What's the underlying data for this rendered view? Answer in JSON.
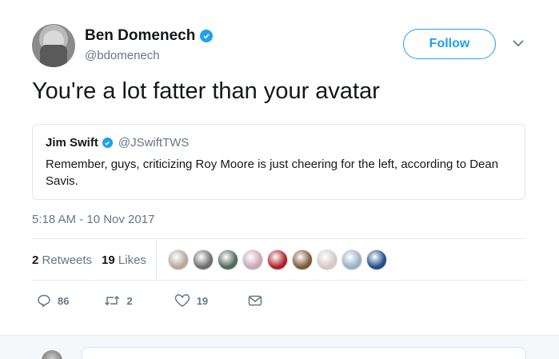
{
  "author": {
    "name": "Ben Domenech",
    "handle": "@bdomenech",
    "avatar_icon": "avatar-photo",
    "verified_icon": "verified-badge-icon"
  },
  "header": {
    "follow_label": "Follow",
    "menu_icon": "chevron-down-icon"
  },
  "tweet": {
    "text": "You're a lot fatter than your avatar",
    "timestamp": "5:18 AM - 10 Nov 2017"
  },
  "quoted_tweet": {
    "name": "Jim Swift",
    "handle": "@JSwiftTWS",
    "text": "Remember, guys, criticizing Roy Moore is just cheering for the left, according to Dean Savis."
  },
  "stats": {
    "retweets_count": "2",
    "retweets_label": "Retweets",
    "likes_count": "19",
    "likes_label": "Likes"
  },
  "likers": [
    {
      "name": "liker-avatar-1",
      "color": "#b7a79a"
    },
    {
      "name": "liker-avatar-2",
      "color": "#6e6e6e"
    },
    {
      "name": "liker-avatar-3",
      "color": "#4d6a5a"
    },
    {
      "name": "liker-avatar-4",
      "color": "#c9a7b5"
    },
    {
      "name": "liker-avatar-5",
      "color": "#b0202a"
    },
    {
      "name": "liker-avatar-6",
      "color": "#7a5a3a"
    },
    {
      "name": "liker-avatar-7",
      "color": "#d6c8c8"
    },
    {
      "name": "liker-avatar-8",
      "color": "#9ab0c8"
    },
    {
      "name": "liker-avatar-9",
      "color": "#1f4e8c"
    }
  ],
  "actions": {
    "reply_count": "86",
    "retweet_count": "2",
    "like_count": "19"
  },
  "colors": {
    "accent": "#1da1f2",
    "secondary_text": "#657786",
    "border": "#e1e8ed"
  }
}
